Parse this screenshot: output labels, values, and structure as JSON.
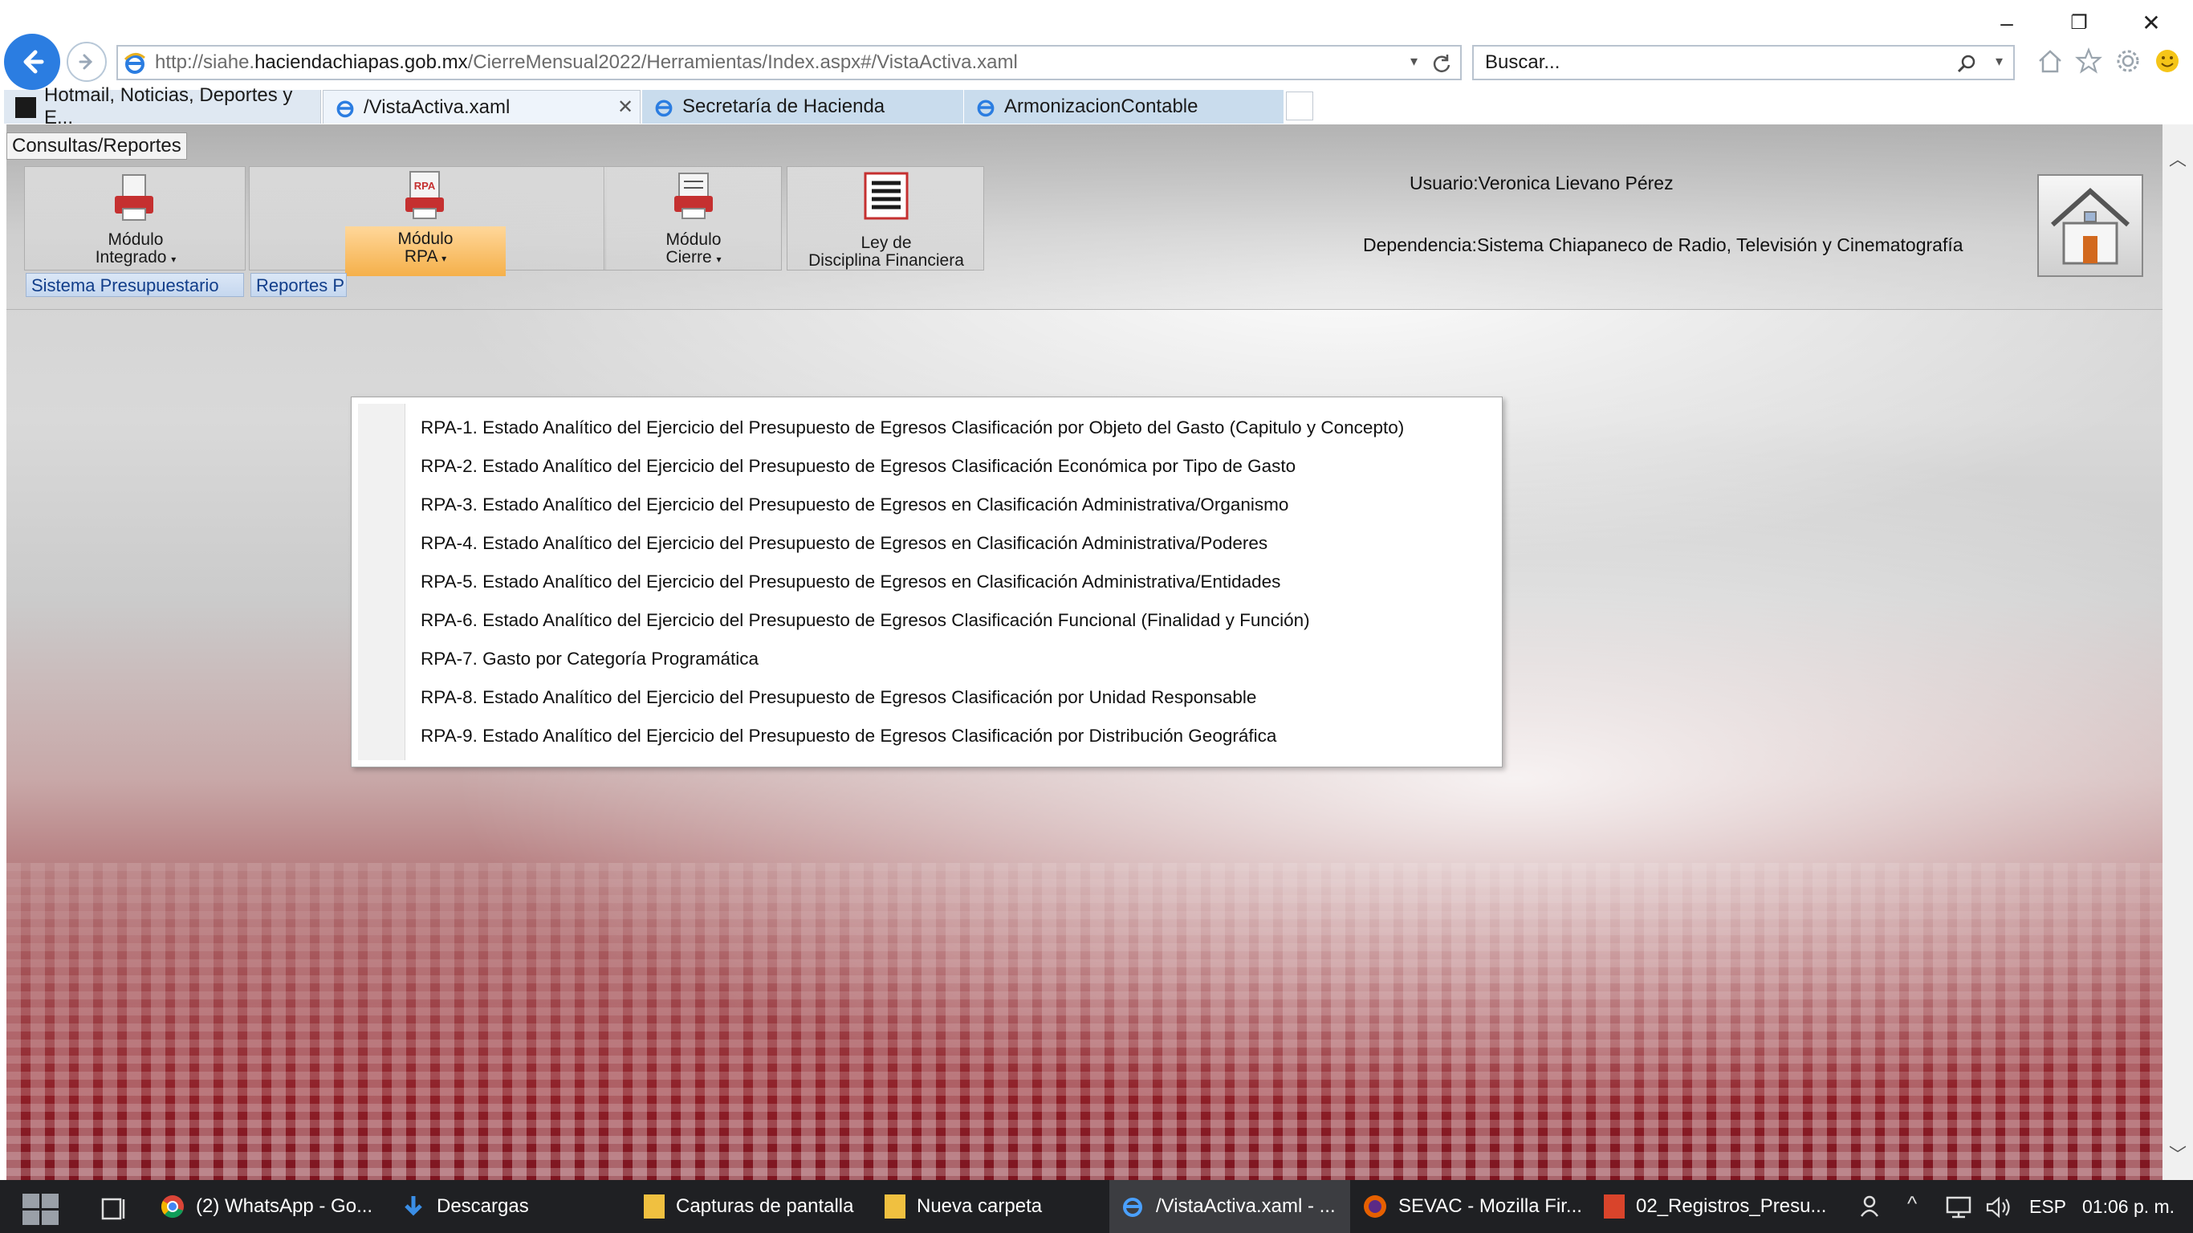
{
  "browser": {
    "url_prefix": "http://siahe.",
    "url_domain": "haciendachiapas.gob.mx",
    "url_path": "/CierreMensual2022/Herramientas/Index.aspx#/VistaActiva.xaml",
    "search_placeholder": "Buscar...",
    "tabs": [
      {
        "label": "Hotmail, Noticias, Deportes y E..."
      },
      {
        "label": "/VistaActiva.xaml"
      },
      {
        "label": "Secretaría de Hacienda"
      },
      {
        "label": "ArmonizacionContable"
      }
    ]
  },
  "ribbon": {
    "tab_label": "Consultas/Reportes",
    "groups": [
      {
        "label": "Sistema Presupuestario"
      },
      {
        "label": "Reportes P"
      }
    ],
    "buttons": {
      "modulo_integrado_1": "Módulo",
      "modulo_integrado_2": "Integrado",
      "modulo_rpa_1": "Módulo",
      "modulo_rpa_2": "RPA",
      "modulo_cierre_1": "Módulo",
      "modulo_cierre_2": "Cierre",
      "ley_1": "Ley de",
      "ley_2": "Disciplina Financiera"
    },
    "icon_rpa_text": "RPA"
  },
  "user": {
    "user_label": "Usuario:",
    "user_name": "Veronica Lievano Pérez",
    "dep_label": "Dependencia:",
    "dep_name": "Sistema Chiapaneco de Radio, Televisión y Cinematografía"
  },
  "rpa_menu": [
    {
      "label": "RPA-1. Estado Analítico del Ejercicio del Presupuesto de Egresos Clasificación por Objeto del Gasto (Capitulo y Concepto)"
    },
    {
      "label": "RPA-2. Estado Analítico del Ejercicio del Presupuesto de Egresos Clasificación Económica por Tipo de Gasto"
    },
    {
      "label": "RPA-3. Estado Analítico del Ejercicio del Presupuesto de Egresos en Clasificación Administrativa/Organismo"
    },
    {
      "label": "RPA-4. Estado Analítico del Ejercicio del Presupuesto de Egresos en Clasificación Administrativa/Poderes"
    },
    {
      "label": "RPA-5. Estado Analítico del Ejercicio del Presupuesto de Egresos en Clasificación Administrativa/Entidades"
    },
    {
      "label": "RPA-6. Estado Analítico del Ejercicio del Presupuesto de Egresos Clasificación Funcional (Finalidad y Función)"
    },
    {
      "label": "RPA-7. Gasto por Categoría Programática"
    },
    {
      "label": "RPA-8. Estado Analítico del Ejercicio del Presupuesto de Egresos Clasificación por Unidad Responsable"
    },
    {
      "label": "RPA-9. Estado Analítico del Ejercicio del Presupuesto de Egresos Clasificación por Distribución Geográfica"
    }
  ],
  "taskbar": {
    "items": [
      {
        "label": "(2) WhatsApp - Go..."
      },
      {
        "label": "Descargas"
      },
      {
        "label": "Capturas de pantalla"
      },
      {
        "label": "Nueva carpeta"
      },
      {
        "label": "/VistaActiva.xaml - ..."
      },
      {
        "label": "SEVAC - Mozilla Fir..."
      },
      {
        "label": "02_Registros_Presu..."
      }
    ],
    "language": "ESP",
    "time": "01:06 p. m."
  },
  "colors": {
    "accent_blue": "#2b7de1",
    "rpa_highlight": "#f5b04a",
    "taskbar_bg": "#1f2023",
    "banner_red": "#8e1f27"
  },
  "icons": [
    "back-arrow-icon",
    "forward-arrow-icon",
    "ie-icon",
    "refresh-icon",
    "search-icon",
    "home-icon",
    "star-icon",
    "gear-icon",
    "smiley-icon",
    "windows-start-icon",
    "task-view-icon",
    "chrome-icon",
    "download-icon",
    "folder-icon",
    "firefox-icon",
    "network-icon",
    "volume-icon",
    "house-icon"
  ]
}
